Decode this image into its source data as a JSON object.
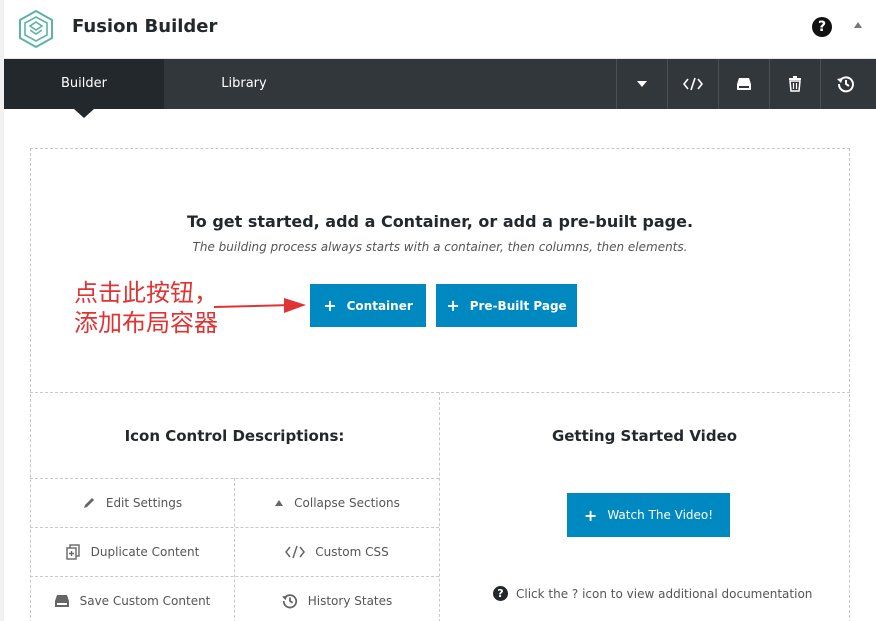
{
  "header": {
    "title": "Fusion Builder",
    "help_icon": "question-circle-icon",
    "collapse_icon": "triangle-up-icon"
  },
  "toolbar": {
    "tabs": [
      {
        "label": "Builder",
        "active": true
      },
      {
        "label": "Library",
        "active": false
      }
    ],
    "icons": [
      "dropdown-caret-icon",
      "code-icon",
      "save-icon",
      "trash-icon",
      "history-icon"
    ]
  },
  "intro": {
    "heading": "To get started, add a Container, or add a pre-built page.",
    "subheading": "The building process always starts with a container, then columns, then elements.",
    "container_button": "Container",
    "prebuilt_button": "Pre-Built Page"
  },
  "annotation": {
    "line1": "点击此按钮，",
    "line2": "添加布局容器",
    "color": "#e03434"
  },
  "icon_descriptions": {
    "title": "Icon Control Descriptions:",
    "items": [
      {
        "label": "Edit Settings",
        "icon": "pencil-icon"
      },
      {
        "label": "Collapse Sections",
        "icon": "triangle-up-icon"
      },
      {
        "label": "Duplicate Content",
        "icon": "duplicate-icon"
      },
      {
        "label": "Custom CSS",
        "icon": "code-icon"
      },
      {
        "label": "Save Custom Content",
        "icon": "save-icon"
      },
      {
        "label": "History States",
        "icon": "history-icon"
      }
    ]
  },
  "video": {
    "title": "Getting Started Video",
    "button": "Watch The Video!",
    "doc_text": "Click the ? icon to view additional documentation"
  },
  "colors": {
    "accent": "#0088c1",
    "toolbar_bg": "#32373c",
    "active_tab_bg": "#23282d"
  }
}
